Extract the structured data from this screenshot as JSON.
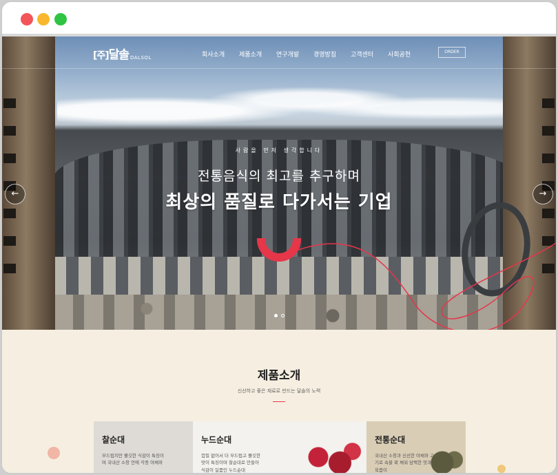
{
  "brand": {
    "bracket": "[주]",
    "name": "달솔",
    "sub": "DALSOL"
  },
  "nav": {
    "items": [
      "회사소개",
      "제품소개",
      "연구개발",
      "경영방침",
      "고객센터",
      "사회공헌"
    ],
    "order_label": "ORDER"
  },
  "hero": {
    "tagline": "사람을 먼저 생각합니다",
    "headline1": "전통음식의 최고를 추구하며",
    "headline2": "최상의 품질로 다가서는 기업",
    "prev_icon": "←",
    "next_icon": "→",
    "slides": 2,
    "active_slide": 1
  },
  "products": {
    "title": "제품소개",
    "subtitle": "신선하고 좋은 재료로 만드는 달솔의 노력",
    "cards": [
      {
        "name": "찰순대",
        "desc": "부드럽지만 쫄깃한 식감이 특징이며 국내산 소창 안에 각종 야채와"
      },
      {
        "name": "누드순대",
        "desc": "껍질 없어서 더 부드럽고 쫄깃한 맛이 특징이며 찰순대로 만들어 식감이 일품인 누드순대"
      },
      {
        "name": "전통순대",
        "desc": "국내산 소창과 신선한 야채와 고기로 속을 꽉 채워 담백한 맛과 육즙이"
      }
    ]
  },
  "colors": {
    "accent": "#e6364a",
    "window_red": "#f2555a",
    "window_yellow": "#f8b72d",
    "window_green": "#2fc443",
    "section_bg": "#f6efe1"
  }
}
